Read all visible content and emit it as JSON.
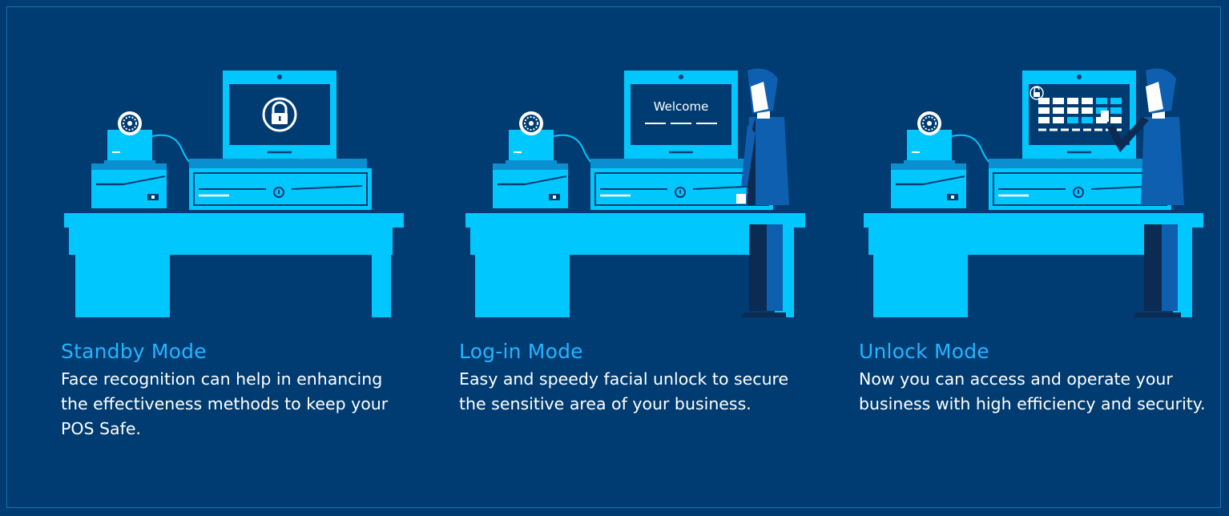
{
  "modes": [
    {
      "title": "Standby Mode",
      "description": "Face recognition can help in enhancing the effectiveness methods to keep your POS Safe.",
      "screen": "lock-icon"
    },
    {
      "title": "Log-in Mode",
      "description": "Easy and speedy facial unlock to secure the sensitive area of your business.",
      "screen": "welcome",
      "screen_text": "Welcome"
    },
    {
      "title": "Unlock Mode",
      "description": "Now you can access and operate your business with high efficiency and security.",
      "screen": "app-grid"
    }
  ],
  "colors": {
    "background": "#003c71",
    "accent": "#00c7fd",
    "title": "#25b4ff",
    "text": "#ffffff",
    "person": "#0e5fb0",
    "dark": "#0b2b52"
  }
}
